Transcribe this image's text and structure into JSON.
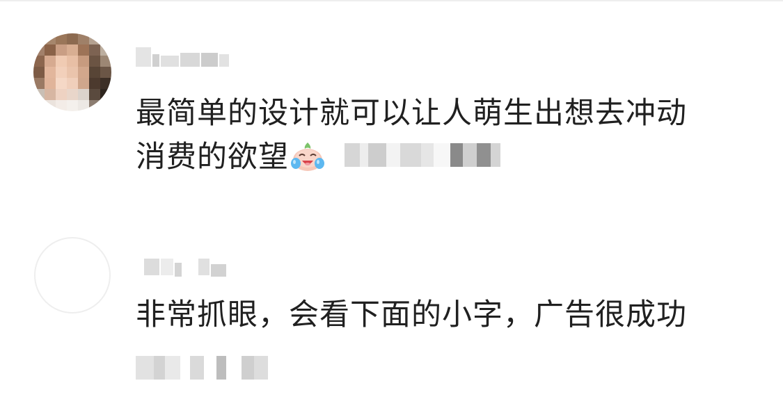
{
  "comments": [
    {
      "username": "",
      "text_line1": "最简单的设计就可以让人萌生出想去冲动",
      "text_line2": "消费的欲望",
      "emoji": "crying-laughing-peach-emoji",
      "avatar": "blurred-photo-avatar"
    },
    {
      "username": "",
      "text_line1": "非常抓眼，会看下面的小字，广告很成功",
      "avatar": "blank-avatar"
    }
  ],
  "colors": {
    "text": "#202020",
    "blur_gray": "#cfcfcf",
    "divider": "#eeeeee"
  }
}
